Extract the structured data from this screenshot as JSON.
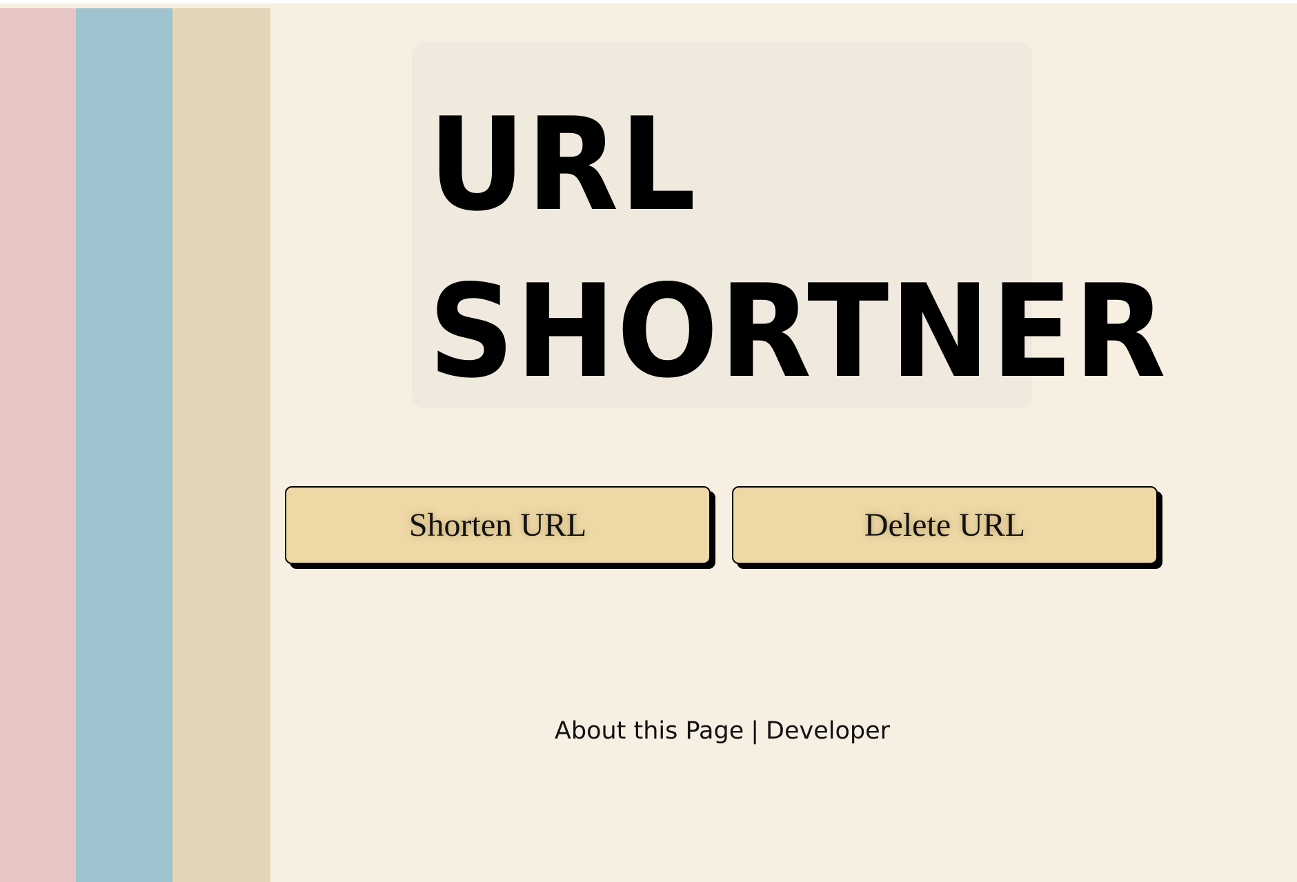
{
  "colors": {
    "background": "#f7efe2",
    "stripe_pink": "#e7c5c5",
    "stripe_blue": "#a0c4cf",
    "stripe_tan": "#e2d5b8",
    "title_card": "#f0e9dd",
    "button_fill": "#eed9a6",
    "text": "#000000"
  },
  "title": {
    "line1": "URL",
    "line2": "SHORTNER"
  },
  "buttons": {
    "shorten_label": "Shorten URL",
    "delete_label": "Delete URL"
  },
  "footer": {
    "about_label": "About this Page",
    "separator": "|",
    "developer_label": "Developer"
  }
}
